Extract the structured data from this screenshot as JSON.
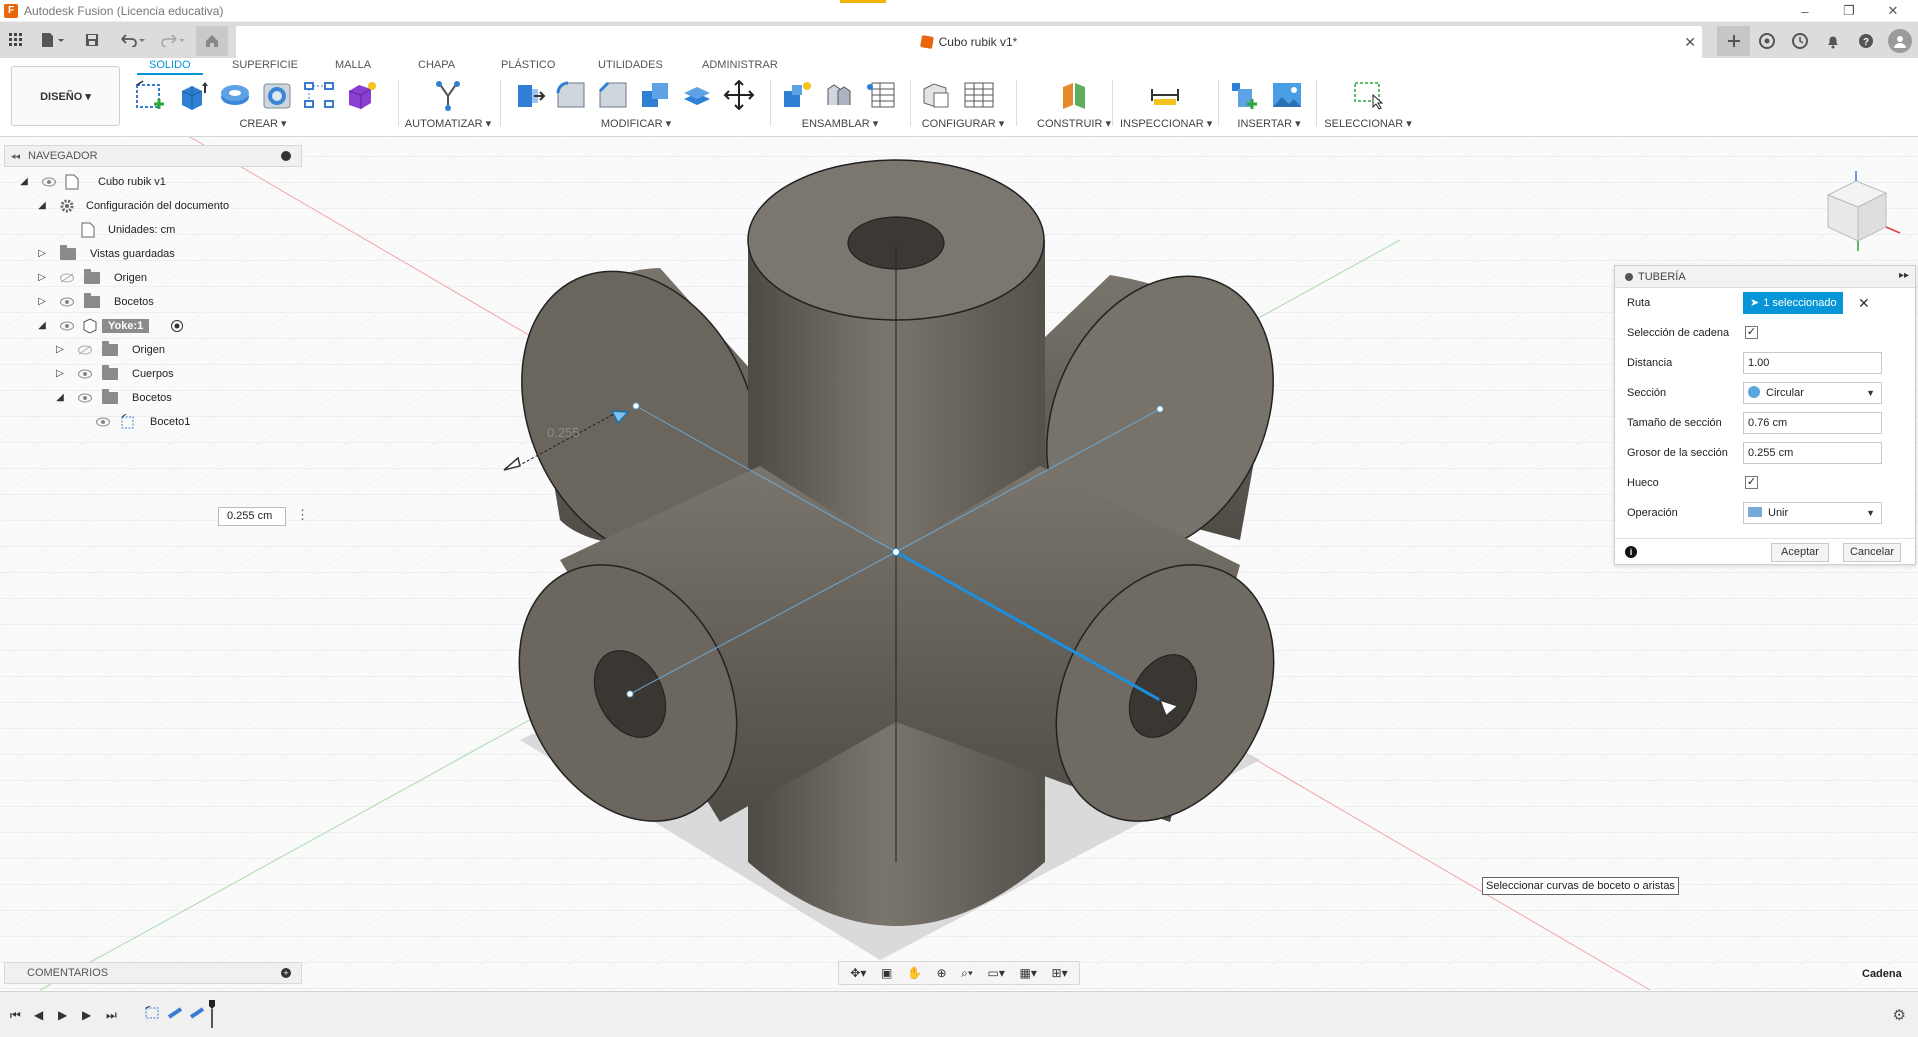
{
  "window": {
    "title": "Autodesk Fusion (Licencia educativa)",
    "controls": [
      "–",
      "❐",
      "✕"
    ]
  },
  "document_tab": {
    "name": "Cubo rubik v1*",
    "close": "✕"
  },
  "ribbon": {
    "tabs": [
      "SOLIDO",
      "SUPERFICIE",
      "MALLA",
      "CHAPA",
      "PLÁSTICO",
      "UTILIDADES",
      "ADMINISTRAR"
    ],
    "active_tab": "SOLIDO",
    "workspace": "DISEÑO ▾",
    "groups": {
      "crear": "CREAR ▾",
      "automatizar": "AUTOMATIZAR ▾",
      "modificar": "MODIFICAR ▾",
      "ensamblar": "ENSAMBLAR ▾",
      "configurar": "CONFIGURAR ▾",
      "construir": "CONSTRUIR ▾",
      "inspeccionar": "INSPECCIONAR ▾",
      "insertar": "INSERTAR ▾",
      "seleccionar": "SELECCIONAR ▾"
    },
    "accent": "#0696d7"
  },
  "navigator": {
    "title": "NAVEGADOR",
    "root": "Cubo rubik v1",
    "items": {
      "doc_settings": "Configuración del documento",
      "units": "Unidades: cm",
      "saved_views": "Vistas guardadas",
      "origin": "Origen",
      "sketches": "Bocetos",
      "component": "Yoke:1",
      "comp_origin": "Origen",
      "bodies": "Cuerpos",
      "comp_sketches": "Bocetos",
      "sketch1": "Boceto1"
    }
  },
  "viewport": {
    "dimension_label": "0.255",
    "dimension_input": "0.255 cm",
    "tooltip": "Seleccionar curvas de boceto o aristas",
    "status": "Cadena",
    "body_color": "#6f6b63",
    "selection_color": "#1b8fe0"
  },
  "comments": {
    "title": "COMENTARIOS"
  },
  "pipe_panel": {
    "title": "TUBERÍA",
    "rows": {
      "ruta_label": "Ruta",
      "ruta_value": "1 seleccionado",
      "cadena_label": "Selección de cadena",
      "cadena_checked": "✓",
      "distancia_label": "Distancia",
      "distancia_value": "1.00",
      "seccion_label": "Sección",
      "seccion_value": "Circular",
      "tamano_label": "Tamaño de sección",
      "tamano_value": "0.76 cm",
      "grosor_label": "Grosor de la sección",
      "grosor_value": "0.255 cm",
      "hueco_label": "Hueco",
      "hueco_checked": "✓",
      "operacion_label": "Operación",
      "operacion_value": "Unir"
    },
    "ok": "Aceptar",
    "cancel": "Cancelar"
  }
}
